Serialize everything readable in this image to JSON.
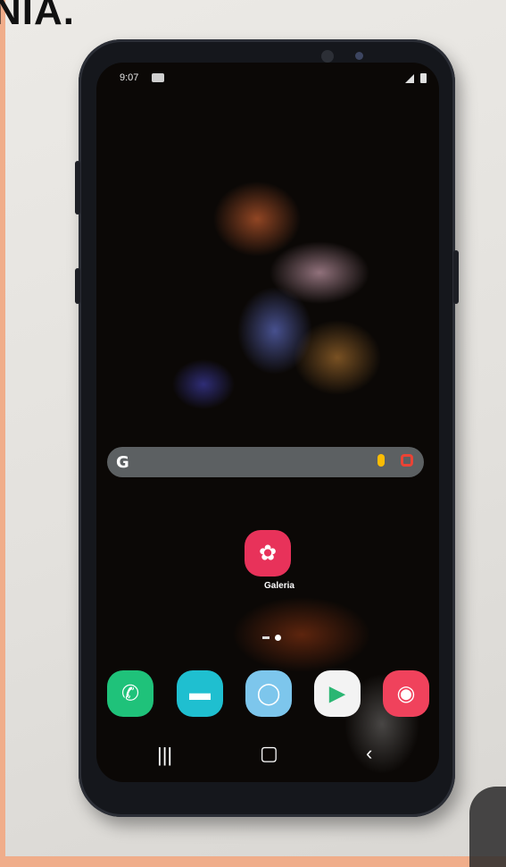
{
  "header": {
    "text": "NIA."
  },
  "status_bar": {
    "time": "9:07"
  },
  "search": {
    "logo": "G",
    "icons": [
      "mic-icon",
      "google-lens-icon"
    ]
  },
  "home": {
    "gallery_label": "Galeria"
  },
  "dock": {
    "apps": [
      "phone",
      "messages",
      "internet",
      "play-store",
      "camera"
    ]
  },
  "navigation": {
    "buttons": [
      "recent-apps",
      "home",
      "back"
    ]
  },
  "colors": {
    "gallery": "#e8325a",
    "phone": "#1fc27a",
    "messages": "#1fbfd0",
    "internet": "#7dc6ec",
    "play_store": "#f3f3f3",
    "camera": "#f0425c"
  }
}
